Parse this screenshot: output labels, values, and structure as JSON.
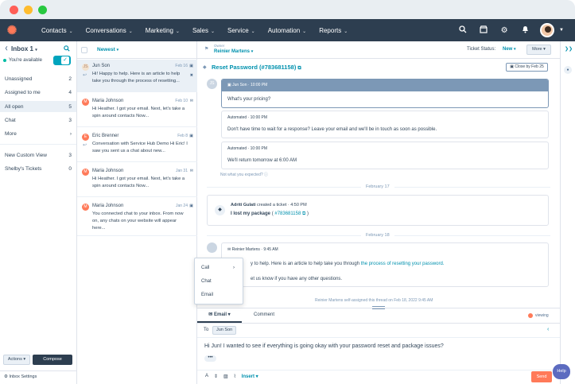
{
  "window": {
    "dot_colors": [
      "#ff5f57",
      "#febc2e",
      "#28c840"
    ]
  },
  "topnav": {
    "items": [
      "Contacts",
      "Conversations",
      "Marketing",
      "Sales",
      "Service",
      "Automation",
      "Reports"
    ],
    "chevron": "⌄"
  },
  "sidebar": {
    "inbox_title": "Inbox 1",
    "availability": "You're available",
    "views": [
      {
        "label": "Unassigned",
        "count": "2"
      },
      {
        "label": "Assigned to me",
        "count": "4"
      },
      {
        "label": "All open",
        "count": "5"
      },
      {
        "label": "Chat",
        "count": "3"
      },
      {
        "label": "More",
        "count": ""
      },
      {
        "label": "New Custom View",
        "count": "3"
      },
      {
        "label": "Shelby's Tickets",
        "count": "0"
      }
    ],
    "actions_label": "Actions ▾",
    "compose_label": "Compose",
    "settings_label": "Inbox Settings"
  },
  "thread_list": {
    "sort_label": "Newest",
    "threads": [
      {
        "name": "Jun Son",
        "date": "Feb 16",
        "preview": "Hi! Happy to help. Here is an article to help take you through the process of resetting..."
      },
      {
        "name": "Maria Johnson",
        "date": "Feb 10",
        "preview": "Hi Heather. I got your email. Next, let's take a spin around contacts Now..."
      },
      {
        "name": "Eric Brenner",
        "date": "Feb 8",
        "preview": "Conversation with Service Hub Demo Hi Eric! I saw you sent us a chat about new..."
      },
      {
        "name": "Maria Johnson",
        "date": "Jan 31",
        "preview": "Hi Heather. I got your email. Next, let's take a spin around contacts Now..."
      },
      {
        "name": "Maria Johnson",
        "date": "Jan 24",
        "preview": "You connected chat to your inbox. From now on, any chats on your website will appear here..."
      }
    ]
  },
  "conversation": {
    "owner_label": "Owner",
    "owner_name": "Reinier Martens",
    "ticket_status_label": "Ticket Status:",
    "ticket_status_value": "New",
    "more_label": "More",
    "ticket_title": "Reset Password (#783681158)",
    "close_by": "Close by Feb 25",
    "messages": [
      {
        "sender": "Jun Son",
        "time": "10:00 PM",
        "text": "What's your pricing?"
      },
      {
        "sender": "Automated",
        "time": "10:00 PM",
        "text": "Don't have time to wait for a response? Leave your email and we'll be in touch as soon as possible."
      },
      {
        "sender": "Automated",
        "time": "10:00 PM",
        "text": "We'll return tomorrow at 6:00 AM"
      }
    ],
    "not_expected": "Not what you expected?",
    "date_sep_1": "February 17",
    "ticket_event": {
      "actor": "Adriti Gulati",
      "action": "created a ticket",
      "time": "4:50 PM",
      "subject": "I lost my package",
      "ticket_id": "#783681158"
    },
    "date_sep_2": "February 18",
    "reply": {
      "sender": "Reinier Martens",
      "time": "9:45 AM",
      "text_pre": "y to help. Here is an article to help take you through",
      "link": "the process of resetting your password.",
      "text2": "et us know if you have any other questions."
    },
    "assign_note": "Reinier Martens self-assigned this thread on Feb 18, 2022 9:45 AM"
  },
  "composer": {
    "tab_email": "Email",
    "tab_comment": "Comment",
    "viewing": "viewing",
    "to_label": "To",
    "to_chip": "Jun Son",
    "body": "Hi Jun! I wanted to see if everything is going okay with your password reset and package issues?",
    "insert_label": "Insert",
    "send_label": "Send"
  },
  "channel_popup": {
    "items": [
      "Call",
      "Chat",
      "Email"
    ]
  },
  "help_label": "Help"
}
